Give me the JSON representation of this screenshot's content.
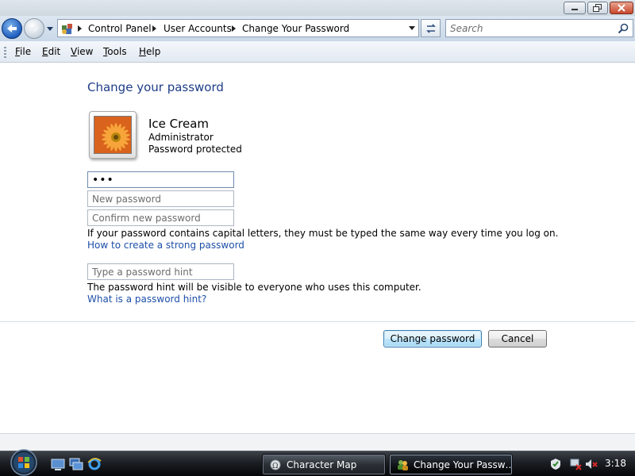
{
  "window": {
    "address_crumbs": [
      "Control Panel",
      "User Accounts",
      "Change Your Password"
    ],
    "search_placeholder": "Search"
  },
  "menu": {
    "items": [
      {
        "ul": "F",
        "rest": "ile"
      },
      {
        "ul": "E",
        "rest": "dit"
      },
      {
        "ul": "V",
        "rest": "iew"
      },
      {
        "ul": "T",
        "rest": "ools"
      },
      {
        "ul": "H",
        "rest": "elp"
      }
    ]
  },
  "page": {
    "heading": "Change your password",
    "user": {
      "name": "Ice Cream",
      "role": "Administrator",
      "status": "Password protected"
    },
    "fields": {
      "current_value": "•••",
      "new_placeholder": "New password",
      "confirm_placeholder": "Confirm new password",
      "hint_placeholder": "Type a password hint"
    },
    "caps_note": "If your password contains capital letters, they must be typed the same way every time you log on.",
    "strong_link": "How to create a strong password",
    "hint_note": "The password hint will be visible to everyone who uses this computer.",
    "hint_link": "What is a password hint?",
    "buttons": {
      "change": "Change password",
      "cancel": "Cancel"
    }
  },
  "taskbar": {
    "tasks": [
      "Character Map",
      "Change Your Passw…"
    ],
    "clock": "3:18"
  },
  "colors": {
    "heading": "#1e3d87",
    "link": "#1d4fa8",
    "taskbar": "#1b1f24"
  }
}
